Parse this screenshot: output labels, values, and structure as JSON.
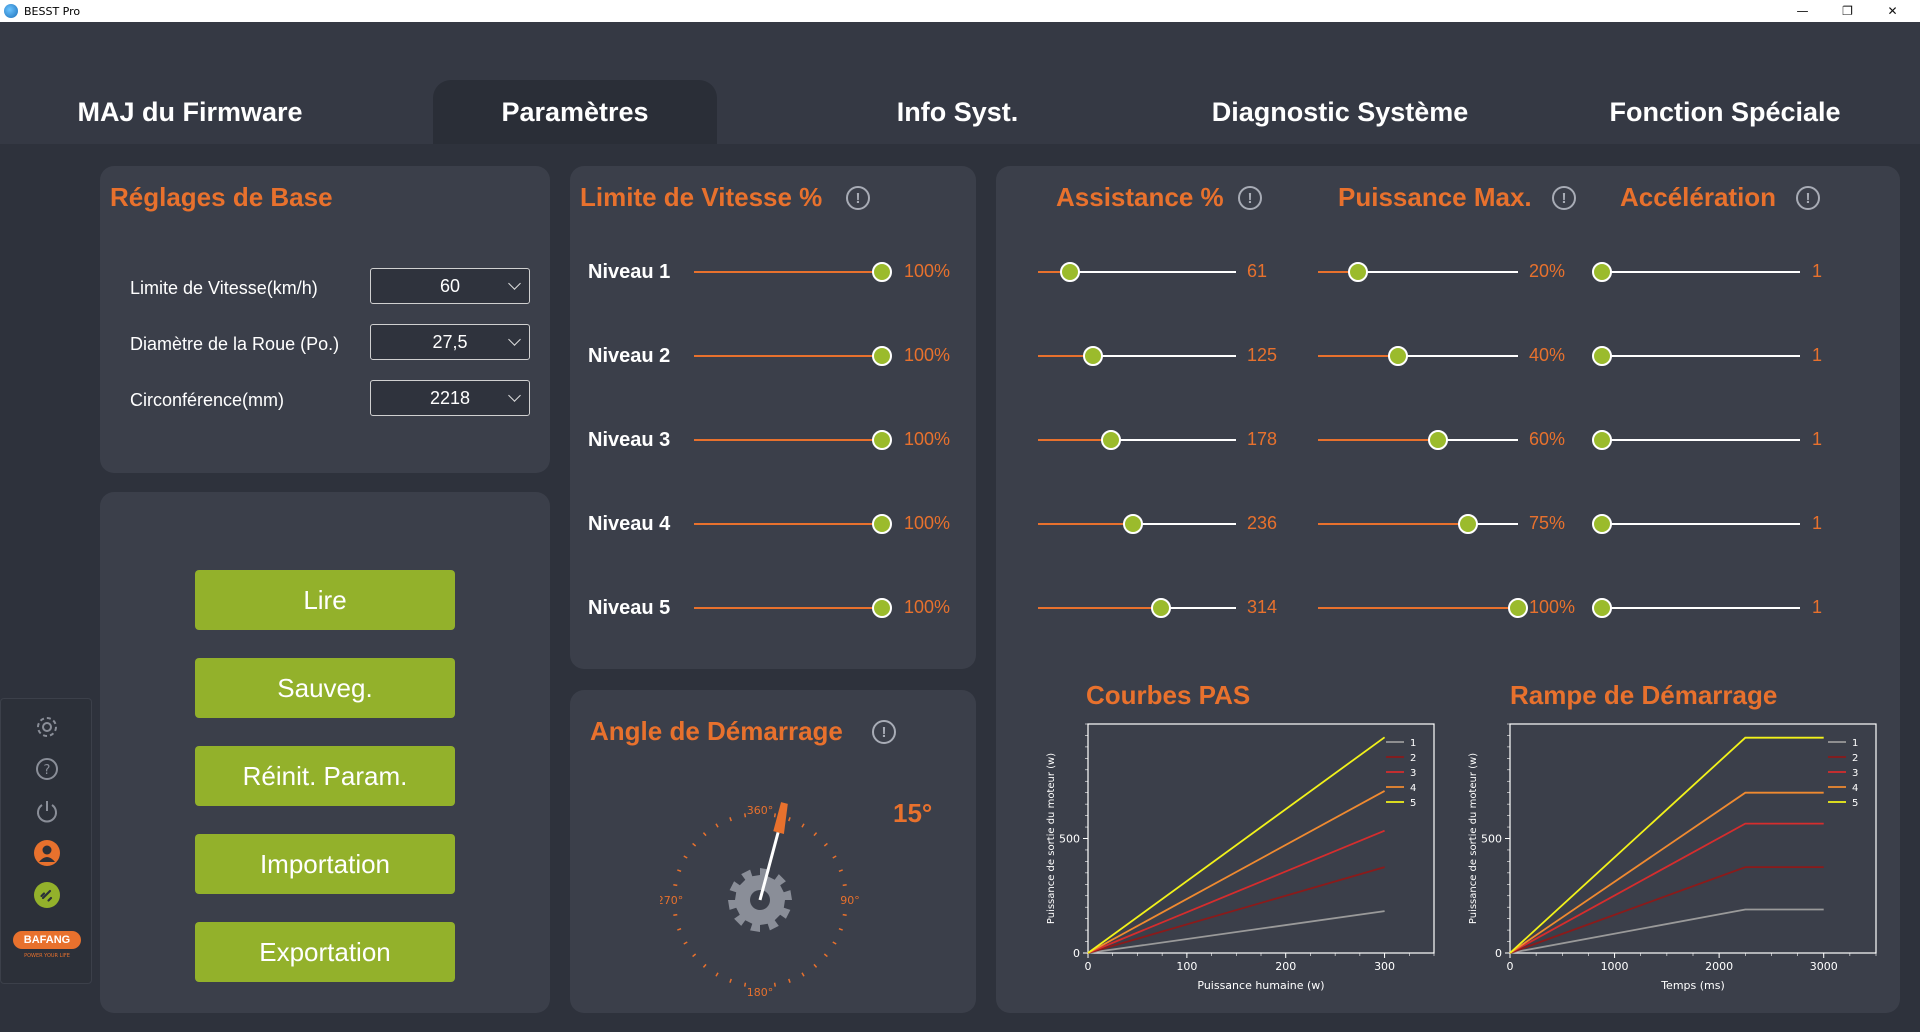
{
  "window": {
    "title": "BESST Pro",
    "minimize": "—",
    "restore": "❐",
    "close": "✕"
  },
  "tabs": [
    {
      "label": "MAJ du Firmware",
      "active": false
    },
    {
      "label": "Paramètres",
      "active": true
    },
    {
      "label": "Info Syst.",
      "active": false
    },
    {
      "label": "Diagnostic Système",
      "active": false
    },
    {
      "label": "Fonction Spéciale",
      "active": false
    }
  ],
  "basic": {
    "title": "Réglages de Base",
    "fields": [
      {
        "label": "Limite de Vitesse(km/h)",
        "value": "60"
      },
      {
        "label": "Diamètre de la Roue (Po.)",
        "value": "27,5"
      },
      {
        "label": "Circonférence(mm)",
        "value": "2218"
      }
    ]
  },
  "actions": {
    "read": "Lire",
    "save": "Sauveg.",
    "reset": "Réinit. Param.",
    "import": "Importation",
    "export": "Exportation"
  },
  "speed_limit": {
    "title": "Limite de Vitesse %",
    "levels": [
      {
        "label": "Niveau 1",
        "value": "100%",
        "fraction": 1.0
      },
      {
        "label": "Niveau 2",
        "value": "100%",
        "fraction": 1.0
      },
      {
        "label": "Niveau 3",
        "value": "100%",
        "fraction": 1.0
      },
      {
        "label": "Niveau 4",
        "value": "100%",
        "fraction": 1.0
      },
      {
        "label": "Niveau 5",
        "value": "100%",
        "fraction": 1.0
      }
    ]
  },
  "start_angle": {
    "title": "Angle de Démarrage",
    "value": "15°",
    "degrees": 15,
    "dial": {
      "top": "360°",
      "right": "90°",
      "bottom": "180°",
      "left": "270°"
    }
  },
  "assist": {
    "title": "Assistance %",
    "rows": [
      {
        "value": "61",
        "fraction": 0.16
      },
      {
        "value": "125",
        "fraction": 0.28
      },
      {
        "value": "178",
        "fraction": 0.37
      },
      {
        "value": "236",
        "fraction": 0.48
      },
      {
        "value": "314",
        "fraction": 0.62
      }
    ]
  },
  "max_power": {
    "title": "Puissance Max.",
    "rows": [
      {
        "value": "20%",
        "fraction": 0.2
      },
      {
        "value": "40%",
        "fraction": 0.4
      },
      {
        "value": "60%",
        "fraction": 0.6
      },
      {
        "value": "75%",
        "fraction": 0.75
      },
      {
        "value": "100%",
        "fraction": 1.0
      }
    ]
  },
  "acceleration": {
    "title": "Accélération",
    "rows": [
      {
        "value": "1",
        "fraction": 0
      },
      {
        "value": "1",
        "fraction": 0
      },
      {
        "value": "1",
        "fraction": 0
      },
      {
        "value": "1",
        "fraction": 0
      },
      {
        "value": "1",
        "fraction": 0
      }
    ]
  },
  "sidebar": {
    "icons": [
      "gear-icon",
      "help-icon",
      "power-icon",
      "user-icon",
      "link-icon"
    ],
    "brand": "BAFANG",
    "brand_tagline": "POWER YOUR LIFE"
  },
  "chart_data": [
    {
      "type": "line",
      "title": "Courbes PAS",
      "xlabel": "Puissance humaine (w)",
      "ylabel": "Puissance de sortie du moteur (w)",
      "xlim": [
        0,
        350
      ],
      "ylim": [
        0,
        1000
      ],
      "xticks": [
        0,
        100,
        200,
        300
      ],
      "yticks": [
        0,
        500
      ],
      "legend": "top-right",
      "colors": [
        "#9a9a9a",
        "#8b1a1a",
        "#d62d2d",
        "#f08a30",
        "#f2f21a"
      ],
      "series": [
        {
          "name": "1",
          "points": [
            [
              0,
              0
            ],
            [
              300,
              183
            ]
          ]
        },
        {
          "name": "2",
          "points": [
            [
              0,
              0
            ],
            [
              300,
              375
            ]
          ]
        },
        {
          "name": "3",
          "points": [
            [
              0,
              0
            ],
            [
              300,
              534
            ]
          ]
        },
        {
          "name": "4",
          "points": [
            [
              0,
              0
            ],
            [
              300,
              708
            ]
          ]
        },
        {
          "name": "5",
          "points": [
            [
              0,
              0
            ],
            [
              300,
              942
            ]
          ]
        }
      ]
    },
    {
      "type": "line",
      "title": "Rampe de Démarrage",
      "xlabel": "Temps (ms)",
      "ylabel": "Puissance de sortie du moteur (w)",
      "xlim": [
        0,
        3500
      ],
      "ylim": [
        0,
        1000
      ],
      "xticks": [
        0,
        1000,
        2000,
        3000
      ],
      "yticks": [
        0,
        500
      ],
      "legend": "top-right",
      "colors": [
        "#9a9a9a",
        "#8b1a1a",
        "#d62d2d",
        "#f08a30",
        "#f2f21a"
      ],
      "series": [
        {
          "name": "1",
          "points": [
            [
              0,
              0
            ],
            [
              2250,
              190
            ],
            [
              3000,
              190
            ]
          ]
        },
        {
          "name": "2",
          "points": [
            [
              0,
              0
            ],
            [
              2250,
              375
            ],
            [
              3000,
              375
            ]
          ]
        },
        {
          "name": "3",
          "points": [
            [
              0,
              0
            ],
            [
              2250,
              565
            ],
            [
              3000,
              565
            ]
          ]
        },
        {
          "name": "4",
          "points": [
            [
              0,
              0
            ],
            [
              2250,
              700
            ],
            [
              3000,
              700
            ]
          ]
        },
        {
          "name": "5",
          "points": [
            [
              0,
              0
            ],
            [
              2250,
              940
            ],
            [
              3000,
              940
            ]
          ]
        }
      ]
    }
  ]
}
